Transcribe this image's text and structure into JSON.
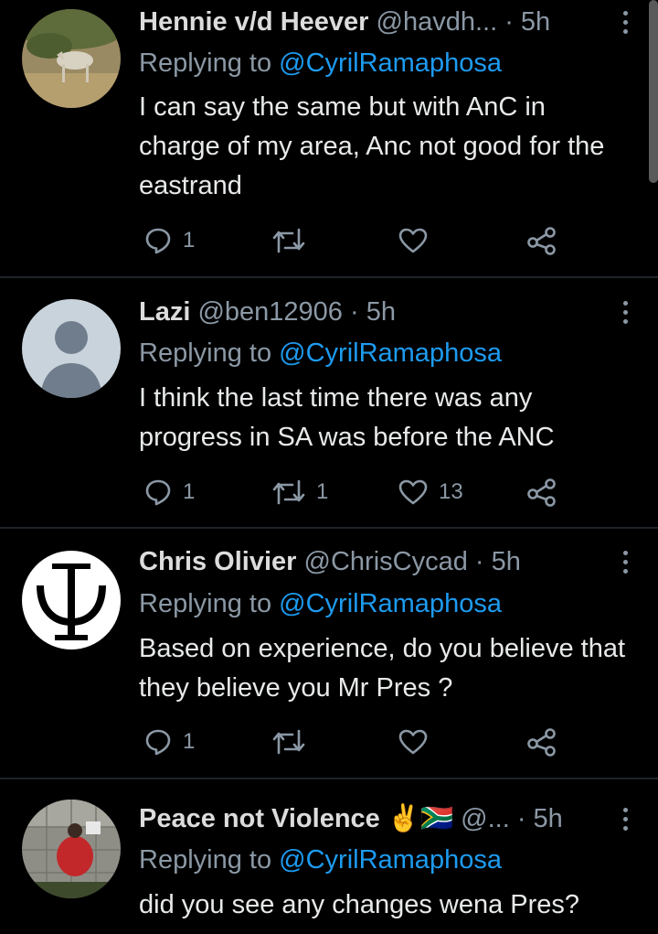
{
  "reply_prefix": "Replying to",
  "tweets": [
    {
      "name": "Hennie v/d Heever",
      "handle": "@havdh...",
      "time": "· 5h",
      "mention": "@CyrilRamaphosa",
      "text": "I can say the same but with AnC in charge of my area, Anc not good for the eastrand",
      "replies": "1",
      "retweets": "",
      "likes": ""
    },
    {
      "name": "Lazi",
      "handle": "@ben12906",
      "time": "· 5h",
      "mention": "@CyrilRamaphosa",
      "text": "I think the last time there was any progress in SA was before the ANC",
      "replies": "1",
      "retweets": "1",
      "likes": "13"
    },
    {
      "name": "Chris Olivier",
      "handle": "@ChrisCycad",
      "time": "· 5h",
      "mention": "@CyrilRamaphosa",
      "text": "Based on experience, do you believe that they believe you Mr Pres ?",
      "replies": "1",
      "retweets": "",
      "likes": ""
    },
    {
      "name": "Peace not Violence ✌️🇿🇦",
      "handle": "@...",
      "time": "· 5h",
      "mention": "@CyrilRamaphosa",
      "text": "did you see any changes wena Pres?",
      "replies": "",
      "retweets": "",
      "likes": ""
    }
  ],
  "colors": {
    "background": "#000000",
    "secondary": "#8b98a5",
    "mention": "#1d9bf0",
    "text": "#e7e9ea"
  }
}
